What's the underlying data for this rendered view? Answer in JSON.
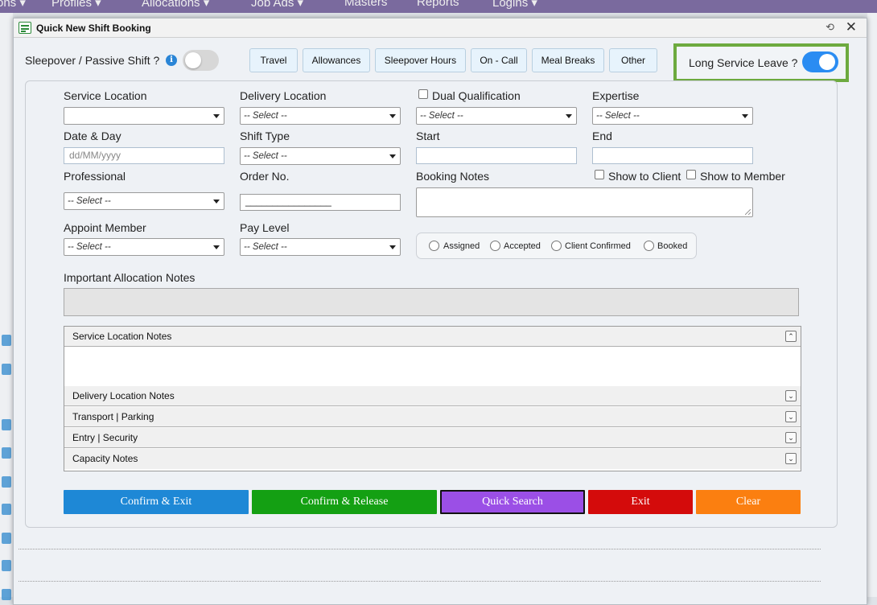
{
  "topnav": {
    "items": [
      "ons ▾",
      "Profiles ▾",
      "Allocations ▾",
      "Job Ads ▾",
      "Masters",
      "Reports",
      "Logins ▾"
    ]
  },
  "dialog": {
    "title": "Quick New Shift Booking",
    "refresh_icon": "⟲",
    "close_icon": "✕"
  },
  "header": {
    "sleepover_label": "Sleepover / Passive Shift ?",
    "sleepover_on": false,
    "info_icon": "i",
    "categories": [
      "Travel",
      "Allowances",
      "Sleepover Hours",
      "On - Call",
      "Meal Breaks",
      "Other"
    ],
    "long_service_label": "Long Service Leave ?",
    "long_service_on": true,
    "highlight_color": "#6daa3f"
  },
  "form": {
    "service_location": {
      "label": "Service Location",
      "value": ""
    },
    "delivery_location": {
      "label": "Delivery Location",
      "value": "-- Select --"
    },
    "dual_qualification": {
      "label": "Dual Qualification",
      "value": "-- Select --"
    },
    "expertise": {
      "label": "Expertise",
      "value": "-- Select --"
    },
    "date_day": {
      "label": "Date & Day",
      "placeholder": "dd/MM/yyyy"
    },
    "shift_type": {
      "label": "Shift Type",
      "value": "-- Select --"
    },
    "start": {
      "label": "Start",
      "value": ""
    },
    "end": {
      "label": "End",
      "value": ""
    },
    "professional": {
      "label": "Professional",
      "value": "-- Select --"
    },
    "order_no": {
      "label": "Order No.",
      "value": "________________"
    },
    "booking_notes": {
      "label": "Booking Notes"
    },
    "show_client": "Show to Client",
    "show_member": "Show to Member",
    "appoint_member": {
      "label": "Appoint Member",
      "value": "-- Select --"
    },
    "pay_level": {
      "label": "Pay Level",
      "value": "-- Select --"
    },
    "statuses": [
      "Assigned",
      "Accepted",
      "Client Confirmed",
      "Booked"
    ],
    "important_notes_label": "Important Allocation Notes"
  },
  "accordions": [
    {
      "label": "Service Location Notes",
      "icon": "⌃"
    },
    {
      "label": "Delivery Location Notes",
      "icon": "⌄"
    },
    {
      "label": "Transport | Parking",
      "icon": "⌄"
    },
    {
      "label": "Entry | Security",
      "icon": "⌄"
    },
    {
      "label": "Capacity Notes",
      "icon": "⌄"
    }
  ],
  "actions": [
    {
      "label": "Confirm & Exit",
      "color": "#1e88d6"
    },
    {
      "label": "Confirm & Release",
      "color": "#14a013"
    },
    {
      "label": "Quick Search",
      "color": "#9b4fe6"
    },
    {
      "label": "Exit",
      "color": "#d40b0b"
    },
    {
      "label": "Clear",
      "color": "#fb7f10"
    }
  ]
}
